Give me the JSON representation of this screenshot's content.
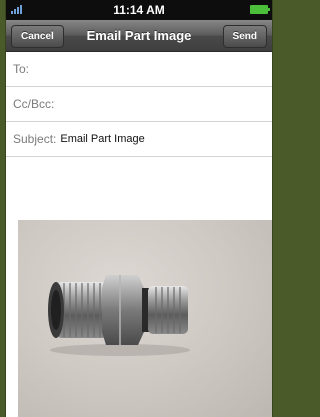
{
  "status_bar": {
    "time": "11:14 AM",
    "signal_icon": "signal-bars-icon",
    "battery_icon": "battery-icon",
    "battery_color": "#4bbf3a"
  },
  "nav": {
    "cancel_label": "Cancel",
    "title": "Email Part Image",
    "send_label": "Send"
  },
  "fields": {
    "to_label": "To:",
    "to_value": "",
    "cc_label": "Cc/Bcc:",
    "cc_value": "",
    "subject_label": "Subject:",
    "subject_value": "Email Part Image"
  },
  "attachment": {
    "icon": "hydraulic-fitting-photo"
  }
}
